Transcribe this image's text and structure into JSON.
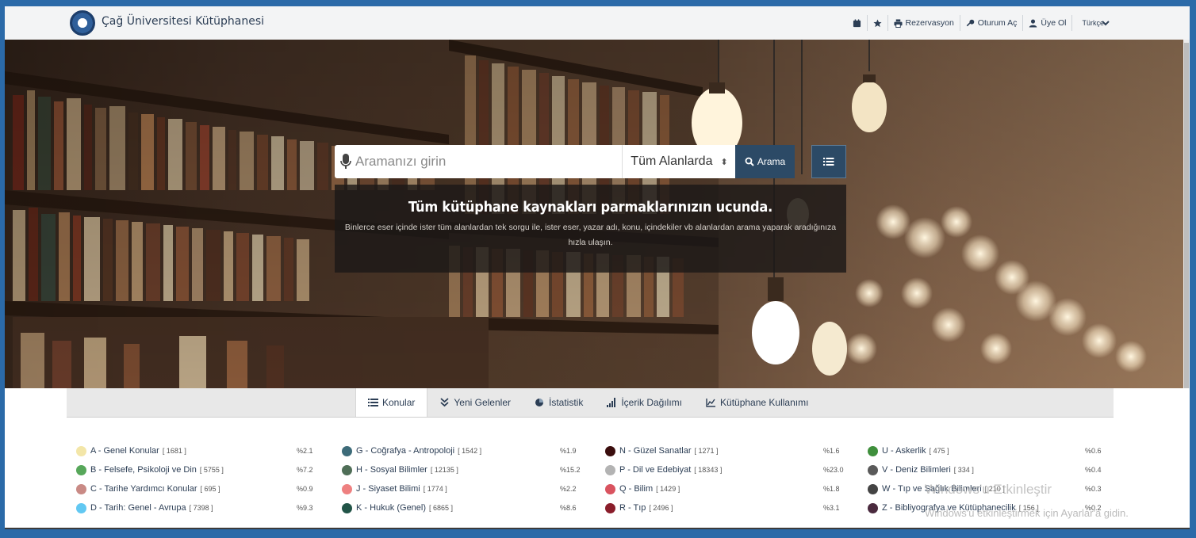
{
  "header": {
    "site_title": "Çağ Üniversitesi Kütüphanesi",
    "nav": [
      {
        "icon": "calendar-icon",
        "label": ""
      },
      {
        "icon": "star-icon",
        "label": ""
      },
      {
        "icon": "printer-icon",
        "label": "Rezervasyon"
      },
      {
        "icon": "key-icon",
        "label": "Oturum Aç"
      },
      {
        "icon": "user-icon",
        "label": "Üye Ol"
      }
    ],
    "language": "Türkçe"
  },
  "search": {
    "placeholder": "Aramanızı girin",
    "scope": "Tüm Alanlarda",
    "button_label": "Arama"
  },
  "info": {
    "title": "Tüm kütüphane kaynakları parmaklarınızın ucunda.",
    "text": "Binlerce eser içinde ister tüm alanlardan tek sorgu ile, ister eser, yazar adı, konu, içindekiler vb alanlardan arama yaparak aradığınıza hızla ulaşın."
  },
  "tabs": [
    {
      "label": "Konular",
      "icon": "list-icon",
      "active": true
    },
    {
      "label": "Yeni Gelenler",
      "icon": "double-chevron-icon",
      "active": false
    },
    {
      "label": "İstatistik",
      "icon": "pie-chart-icon",
      "active": false
    },
    {
      "label": "İçerik Dağılımı",
      "icon": "bar-signal-icon",
      "active": false
    },
    {
      "label": "Kütüphane Kullanımı",
      "icon": "line-chart-icon",
      "active": false
    }
  ],
  "subjects": [
    [
      {
        "name": "A - Genel Konular",
        "count": "[ 1681 ]",
        "pct": "%2.1",
        "color": "#f3e6a8"
      },
      {
        "name": "B - Felsefe, Psikoloji ve Din",
        "count": "[ 5755 ]",
        "pct": "%7.2",
        "color": "#57a75a"
      },
      {
        "name": "C - Tarihe Yardımcı Konular",
        "count": "[ 695 ]",
        "pct": "%0.9",
        "color": "#c98a85"
      },
      {
        "name": "D - Tarih: Genel - Avrupa",
        "count": "[ 7398 ]",
        "pct": "%9.3",
        "color": "#62c8f2"
      }
    ],
    [
      {
        "name": "G - Coğrafya - Antropoloji",
        "count": "[ 1542 ]",
        "pct": "%1.9",
        "color": "#3d6b79"
      },
      {
        "name": "H - Sosyal Bilimler",
        "count": "[ 12135 ]",
        "pct": "%15.2",
        "color": "#4f6e57"
      },
      {
        "name": "J - Siyaset Bilimi",
        "count": "[ 1774 ]",
        "pct": "%2.2",
        "color": "#ee8080"
      },
      {
        "name": "K - Hukuk (Genel)",
        "count": "[ 6865 ]",
        "pct": "%8.6",
        "color": "#215447"
      }
    ],
    [
      {
        "name": "N - Güzel Sanatlar",
        "count": "[ 1271 ]",
        "pct": "%1.6",
        "color": "#3a0d0d"
      },
      {
        "name": "P - Dil ve Edebiyat",
        "count": "[ 18343 ]",
        "pct": "%23.0",
        "color": "#b3b3b3"
      },
      {
        "name": "Q - Bilim",
        "count": "[ 1429 ]",
        "pct": "%1.8",
        "color": "#d9535f"
      },
      {
        "name": "R - Tıp",
        "count": "[ 2496 ]",
        "pct": "%3.1",
        "color": "#8a1d2a"
      }
    ],
    [
      {
        "name": "U - Askerlik",
        "count": "[ 475 ]",
        "pct": "%0.6",
        "color": "#3f8f3c"
      },
      {
        "name": "V - Deniz Bilimleri",
        "count": "[ 334 ]",
        "pct": "%0.4",
        "color": "#5a5a5a"
      },
      {
        "name": "W - Tıp ve Sağlık Bilimleri",
        "count": "[ 210 ]",
        "pct": "%0.3",
        "color": "#444"
      },
      {
        "name": "Z - Bibliyografya ve Kütüphanecilik",
        "count": "[ 156 ]",
        "pct": "%0.2",
        "color": "#4a2a3e"
      }
    ]
  ],
  "watermark": {
    "line1": "Windows'u Etkinleştir",
    "line2": "Windows'u etkinleştirmek için Ayarlar'a gidin."
  }
}
